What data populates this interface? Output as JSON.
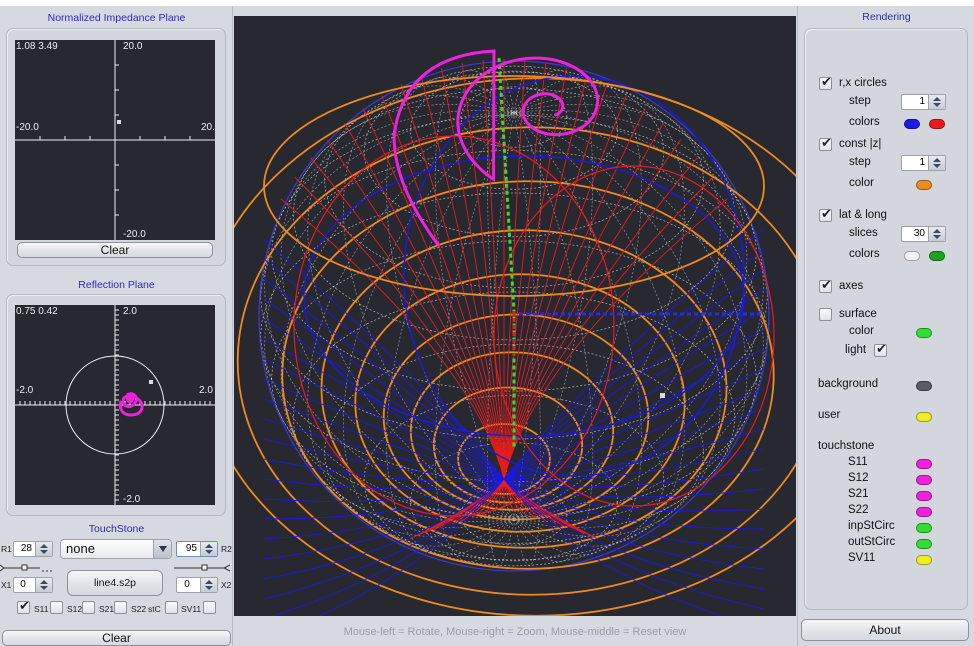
{
  "left": {
    "impedance": {
      "title": "Normalized Impedance Plane",
      "readout": "1.08 3.49",
      "y_max": "20.0",
      "y_min": "-20.0",
      "x_min": "-20.0",
      "x_max": "20.",
      "clear_label": "Clear"
    },
    "reflection": {
      "title": "Reflection Plane",
      "readout": "0.75 0.42",
      "y_max": "2.0",
      "y_min": "-2.0",
      "x_min": "-2.0",
      "x_max": "2.0"
    },
    "touchstone": {
      "title": "TouchStone",
      "r1_label": "R1",
      "r1_value": "28",
      "x1_label": "X1",
      "x1_value": "0",
      "r2_label": "R2",
      "r2_value": "95",
      "x2_label": "X2",
      "x2_value": "0",
      "combo_value": "none",
      "file_button": "line4.s2p",
      "checks": [
        {
          "label": "S11",
          "checked": true
        },
        {
          "label": "S12",
          "checked": false
        },
        {
          "label": "S21",
          "checked": false
        },
        {
          "label": "S22",
          "checked": false
        },
        {
          "label": "stC",
          "checked": false
        },
        {
          "label": "SV11",
          "checked": false
        }
      ],
      "clear_label": "Clear"
    }
  },
  "center": {
    "hint": "Mouse-left = Rotate, Mouse-right = Zoom, Mouse-middle = Reset view"
  },
  "right": {
    "title": "Rendering",
    "rx_circles": {
      "label": "r,x circles",
      "checked": true,
      "step_label": "step",
      "step_value": "1",
      "colors_label": "colors",
      "colors": [
        "#1a1ae0",
        "#e81c1c"
      ]
    },
    "const_z": {
      "label": "const |z|",
      "checked": true,
      "step_label": "step",
      "step_value": "1",
      "color_label": "color",
      "color": "#ee8a22"
    },
    "lat_long": {
      "label": "lat & long",
      "checked": true,
      "slices_label": "slices",
      "slices_value": "30",
      "colors_label": "colors",
      "colors": [
        "#f4f4f4",
        "#22a022"
      ]
    },
    "axes": {
      "label": "axes",
      "checked": true
    },
    "surface": {
      "label": "surface",
      "checked": false,
      "color_label": "color",
      "color": "#33dd33",
      "light_label": "light",
      "light_checked": true
    },
    "background": {
      "label": "background",
      "color": "#5a5c62"
    },
    "user": {
      "label": "user",
      "color": "#eeee22"
    },
    "touchstone": {
      "label": "touchstone",
      "items": [
        {
          "label": "S11",
          "color": "#ee22dd"
        },
        {
          "label": "S12",
          "color": "#ee22dd"
        },
        {
          "label": "S21",
          "color": "#ee22dd"
        },
        {
          "label": "S22",
          "color": "#ee22dd"
        },
        {
          "label": "inpStCirc",
          "color": "#33dd33"
        },
        {
          "label": "outStCirc",
          "color": "#33dd33"
        },
        {
          "label": "SV11",
          "color": "#eeee22"
        }
      ]
    },
    "about_label": "About"
  },
  "colors": {
    "plot_bg": "#272830",
    "title_blue": "#2b2bb8",
    "trace_magenta": "#ee22dd"
  }
}
